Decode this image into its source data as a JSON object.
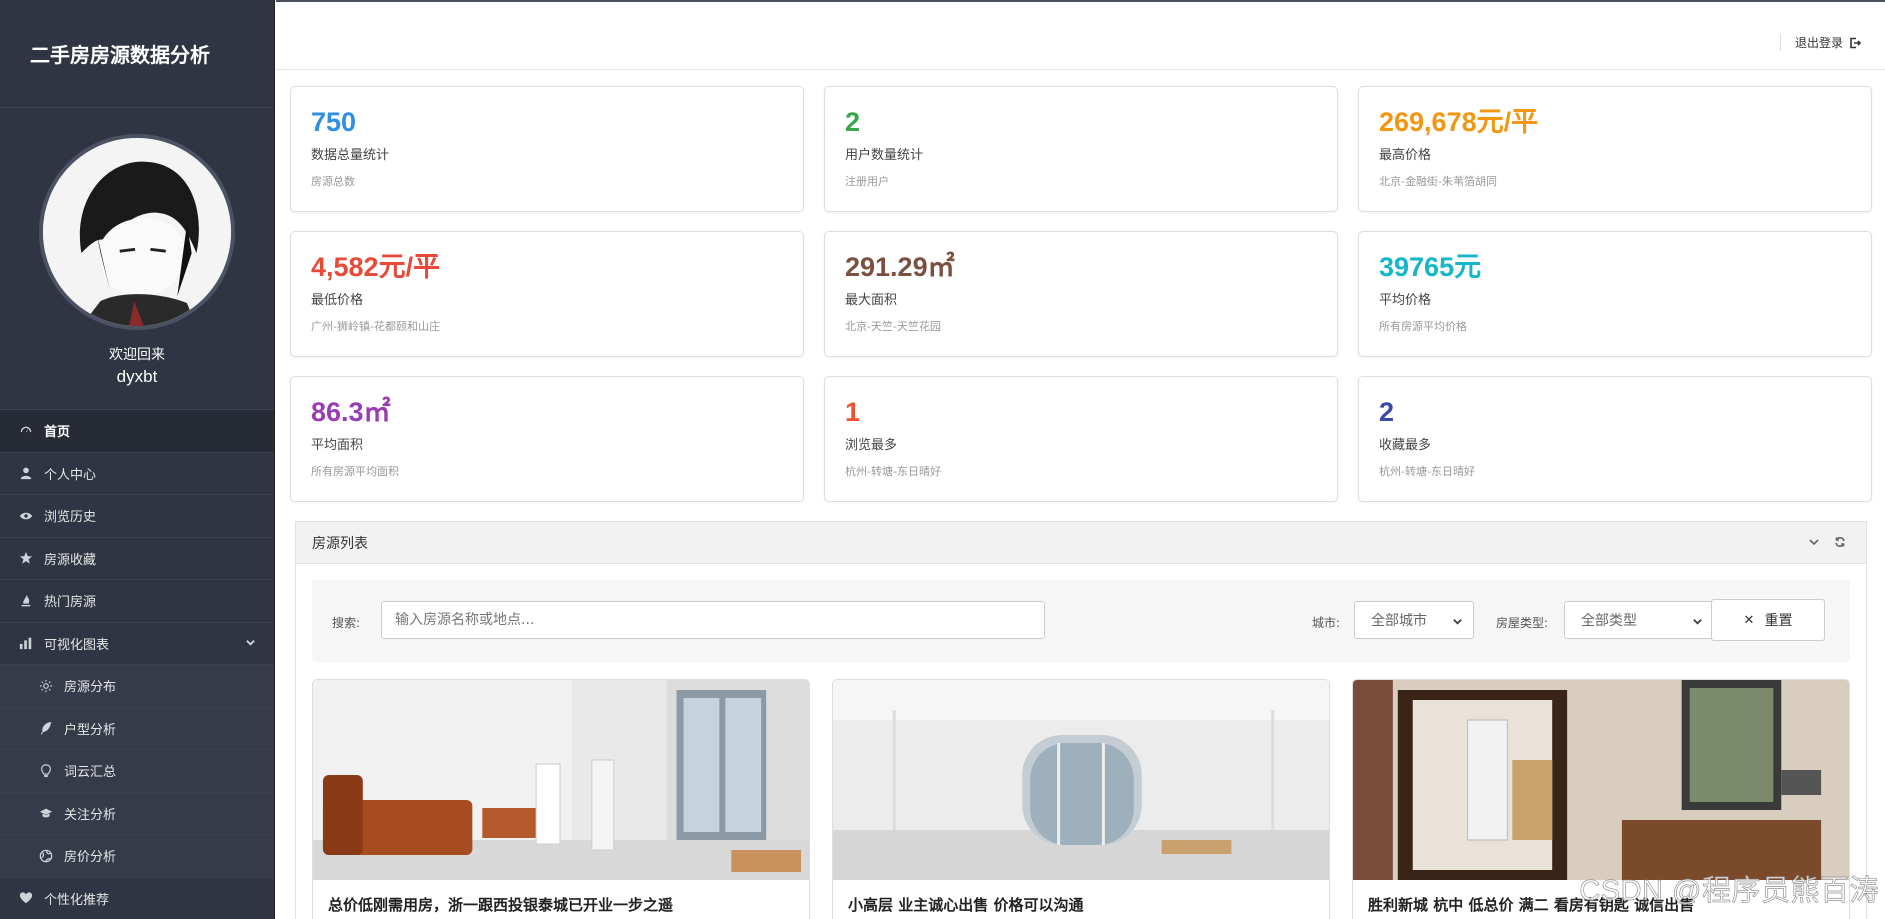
{
  "app": {
    "title": "二手房房源数据分析"
  },
  "profile": {
    "welcome": "欢迎回来",
    "username": "dyxbt"
  },
  "nav": {
    "home": "首页",
    "personal": "个人中心",
    "history": "浏览历史",
    "favorites": "房源收藏",
    "hot": "热门房源",
    "charts": "可视化图表",
    "charts_sub": [
      "房源分布",
      "户型分析",
      "词云汇总",
      "关注分析",
      "房价分析"
    ],
    "recommend": "个性化推荐"
  },
  "topbar": {
    "logout": "退出登录"
  },
  "stats": [
    {
      "value": "750",
      "label": "数据总量统计",
      "sub": "房源总数",
      "color": "#2f8fe6"
    },
    {
      "value": "2",
      "label": "用户数量统计",
      "sub": "注册用户",
      "color": "#3aa84a"
    },
    {
      "value": "269,678元/平",
      "label": "最高价格",
      "sub": "北京-金融街-朱苇箔胡同",
      "color": "#f39612"
    },
    {
      "value": "4,582元/平",
      "label": "最低价格",
      "sub": "广州-狮岭镇-花都颐和山庄",
      "color": "#e84a3a"
    },
    {
      "value": "291.29㎡",
      "label": "最大面积",
      "sub": "北京-天竺-天竺花园",
      "color": "#7b5040"
    },
    {
      "value": "39765元",
      "label": "平均价格",
      "sub": "所有房源平均价格",
      "color": "#15b5cc"
    },
    {
      "value": "86.3㎡",
      "label": "平均面积",
      "sub": "所有房源平均面积",
      "color": "#9a3cb3"
    },
    {
      "value": "1",
      "label": "浏览最多",
      "sub": "杭州-转塘-东日晴好",
      "color": "#f0522d"
    },
    {
      "value": "2",
      "label": "收藏最多",
      "sub": "杭州-转塘-东日晴好",
      "color": "#3a4aa8"
    }
  ],
  "panel": {
    "title": "房源列表",
    "search_label": "搜索:",
    "search_placeholder": "输入房源名称或地点...",
    "city_label": "城市:",
    "city_value": "全部城市",
    "type_label": "房屋类型:",
    "type_value": "全部类型",
    "reset": "重置"
  },
  "listings": [
    {
      "title": "总价低刚需用房，浙一跟西投银泰城已开业一步之遥"
    },
    {
      "title": "小高层 业主诚心出售 价格可以沟通"
    },
    {
      "title": "胜利新城 杭中 低总价 满二 看房有钥匙 诚信出售"
    }
  ],
  "watermark": "CSDN @程序员熊百涛",
  "colors": {
    "sidebar": "#2f3542",
    "sidebar_active": "#262b36"
  }
}
